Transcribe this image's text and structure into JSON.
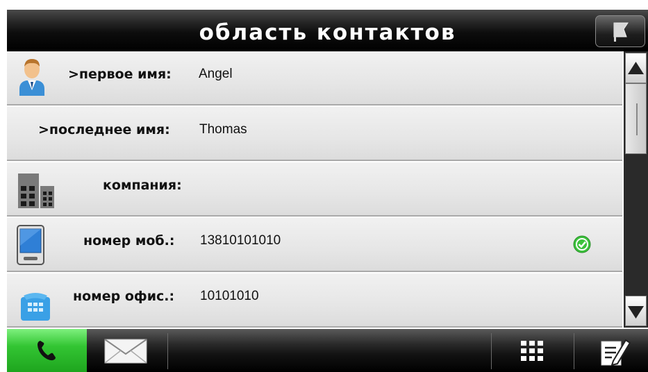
{
  "header": {
    "title": "область контактов",
    "back_icon": "flag-back-icon"
  },
  "contact": {
    "rows": [
      {
        "icon": "person-icon",
        "label": ">первое имя:",
        "value": "Angel"
      },
      {
        "icon": "",
        "label": ">последнее имя:",
        "value": "Thomas"
      },
      {
        "icon": "building-icon",
        "label": "компания:",
        "value": ""
      },
      {
        "icon": "mobile-phone-icon",
        "label": "номер моб.:",
        "value": "13810101010",
        "status_icon": "check-circle-icon"
      },
      {
        "icon": "office-phone-icon",
        "label": "номер офис.:",
        "value": "10101010"
      }
    ]
  },
  "toolbar": {
    "call_icon": "phone-handset-icon",
    "message_icon": "envelope-icon",
    "keypad_icon": "keypad-grid-icon",
    "edit_icon": "edit-note-icon"
  },
  "colors": {
    "accent_green": "#2fbf2f",
    "check_green": "#3cc23c",
    "header_black": "#0d0d0d"
  }
}
